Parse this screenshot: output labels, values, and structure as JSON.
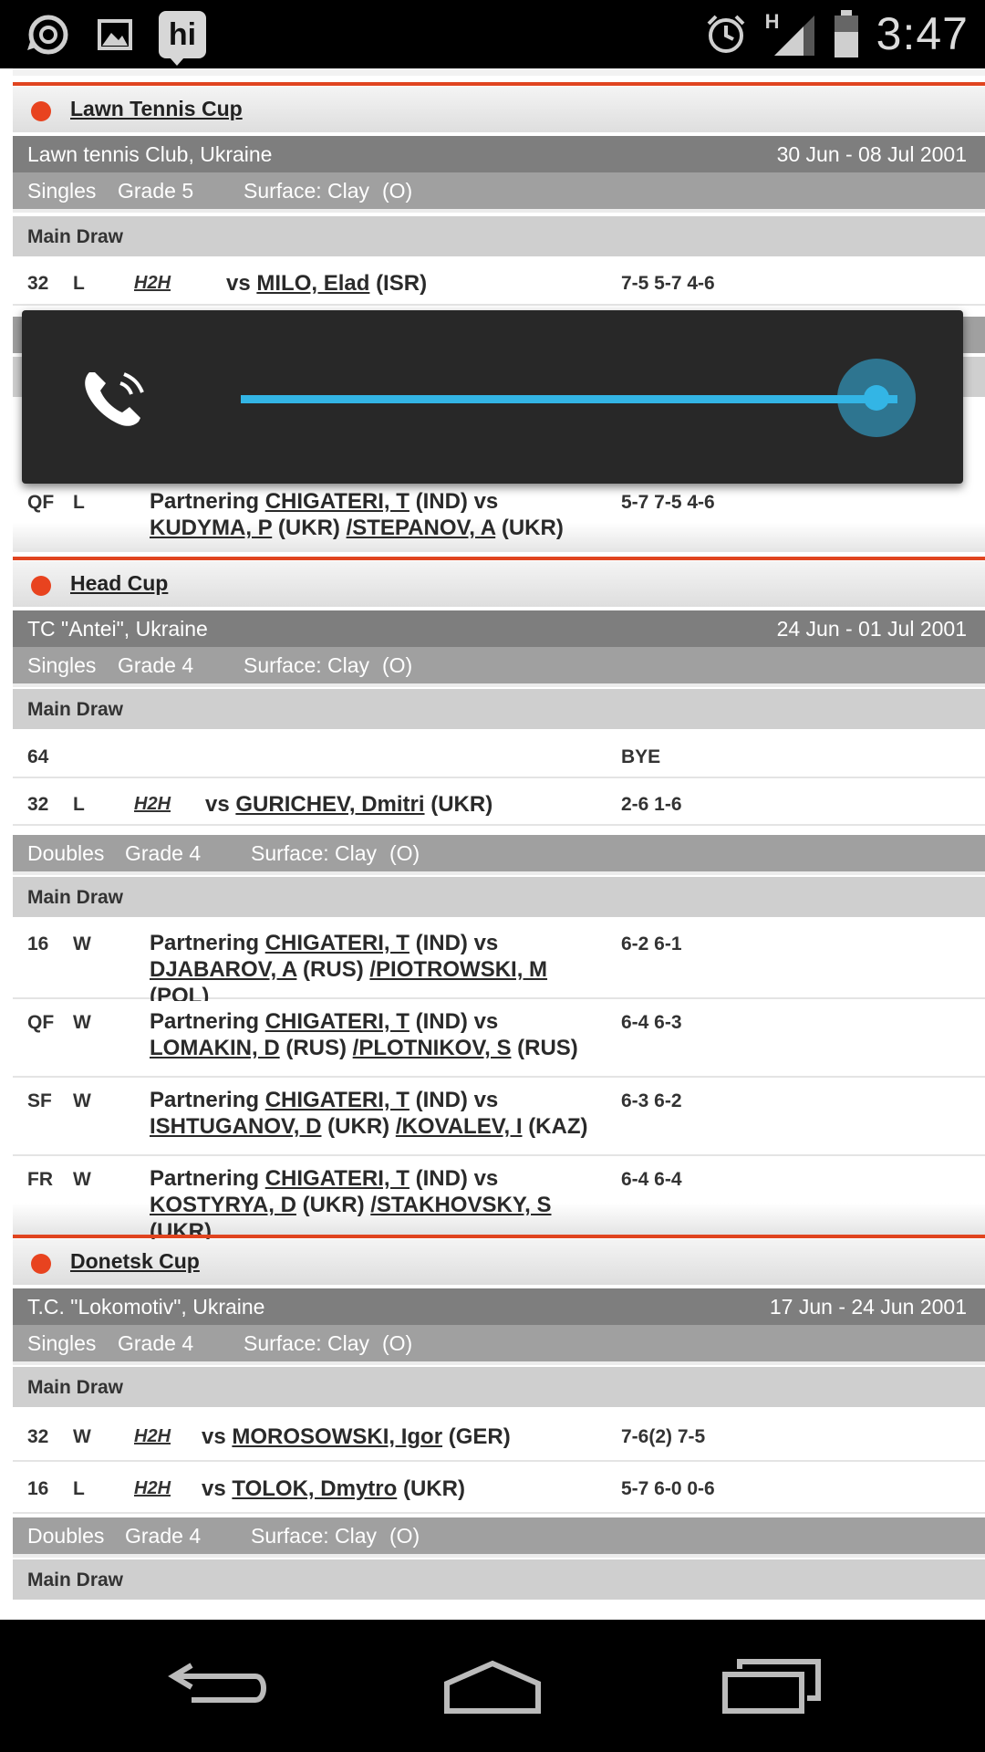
{
  "status_bar": {
    "time": "3:47",
    "network": "H",
    "icons": [
      "sync-icon",
      "image-icon",
      "hi-app-icon",
      "alarm-icon",
      "signal-icon",
      "battery-icon"
    ],
    "hi_label": "hi"
  },
  "sections": [
    {
      "title": "Lawn Tennis Cup",
      "venue": "Lawn tennis Club, Ukraine",
      "dates": "30 Jun - 08 Jul 2001",
      "events": [
        {
          "type": "Singles",
          "grade": "Grade 5",
          "surface": "Surface: Clay",
          "io": "(O)",
          "draw": "Main Draw",
          "matches": [
            {
              "round": "32",
              "result": "L",
              "h2h": "H2H",
              "vs": "vs",
              "opponent": "MILO, Elad",
              "country": "(ISR)",
              "score": "7-5 5-7 4-6"
            }
          ]
        },
        {
          "draw": "",
          "matches": [
            {
              "round": "QF",
              "result": "L",
              "partner_prefix": "Partnering",
              "partner": "CHIGATERI, T",
              "partner_country": "(IND) vs",
              "opp1": "KUDYMA, P",
              "opp1_country": "(UKR)",
              "opp2": "/STEPANOV, A",
              "opp2_country": "(UKR)",
              "score": "5-7 7-5 4-6"
            }
          ]
        }
      ]
    },
    {
      "title": "Head Cup",
      "venue": "TC \"Antei\", Ukraine",
      "dates": "24 Jun - 01 Jul 2001",
      "events": [
        {
          "type": "Singles",
          "grade": "Grade 4",
          "surface": "Surface: Clay",
          "io": "(O)",
          "draw": "Main Draw",
          "matches": [
            {
              "round": "64",
              "score": "BYE"
            },
            {
              "round": "32",
              "result": "L",
              "h2h": "H2H",
              "vs": "vs",
              "opponent": "GURICHEV, Dmitri",
              "country": "(UKR)",
              "score": "2-6 1-6"
            }
          ]
        },
        {
          "type": "Doubles",
          "grade": "Grade 4",
          "surface": "Surface: Clay",
          "io": "(O)",
          "draw": "Main Draw",
          "matches": [
            {
              "round": "16",
              "result": "W",
              "partner_prefix": "Partnering",
              "partner": "CHIGATERI, T",
              "partner_country": "(IND) vs",
              "opp1": "DJABAROV, A",
              "opp1_country": "(RUS)",
              "opp2": "/PIOTROWSKI, M",
              "opp2_country": "(POL)",
              "score": "6-2 6-1"
            },
            {
              "round": "QF",
              "result": "W",
              "partner_prefix": "Partnering",
              "partner": "CHIGATERI, T",
              "partner_country": "(IND) vs",
              "opp1": "LOMAKIN, D",
              "opp1_country": "(RUS)",
              "opp2": "/PLOTNIKOV, S",
              "opp2_country": "(RUS)",
              "score": "6-4 6-3"
            },
            {
              "round": "SF",
              "result": "W",
              "partner_prefix": "Partnering",
              "partner": "CHIGATERI, T",
              "partner_country": "(IND) vs",
              "opp1": "ISHTUGANOV, D",
              "opp1_country": "(UKR)",
              "opp2": "/KOVALEV, I",
              "opp2_country": "(KAZ)",
              "score": "6-3 6-2"
            },
            {
              "round": "FR",
              "result": "W",
              "partner_prefix": "Partnering",
              "partner": "CHIGATERI, T",
              "partner_country": "(IND) vs",
              "opp1": "KOSTYRYA, D",
              "opp1_country": "(UKR)",
              "opp2": "/STAKHOVSKY, S",
              "opp2_country": "(UKR)",
              "score": "6-4 6-4"
            }
          ]
        }
      ]
    },
    {
      "title": "Donetsk Cup",
      "venue": "T.C. \"Lokomotiv\", Ukraine",
      "dates": "17 Jun - 24 Jun 2001",
      "events": [
        {
          "type": "Singles",
          "grade": "Grade 4",
          "surface": "Surface: Clay",
          "io": "(O)",
          "draw": "Main Draw",
          "matches": [
            {
              "round": "32",
              "result": "W",
              "h2h": "H2H",
              "vs": "vs",
              "opponent": "MOROSOWSKI, Igor",
              "country": "(GER)",
              "score": "7-6(2) 7-5"
            },
            {
              "round": "16",
              "result": "L",
              "h2h": "H2H",
              "vs": "vs",
              "opponent": "TOLOK, Dmytro",
              "country": "(UKR)",
              "score": "5-7 6-0 0-6"
            }
          ]
        },
        {
          "type": "Doubles",
          "grade": "Grade 4",
          "surface": "Surface: Clay",
          "io": "(O)",
          "draw": "Main Draw",
          "matches": []
        }
      ]
    }
  ],
  "volume_overlay": {
    "stream_icon": "phone-in-call-icon",
    "level": 1.0,
    "accent": "#33b5e5"
  },
  "nav_bar": {
    "buttons": [
      "back-icon",
      "home-icon",
      "recent-apps-icon"
    ]
  },
  "colors": {
    "accent_orange": "#e0441f",
    "venue_bar": "#7e7e7e",
    "grade_bar": "#a0a0a0",
    "draw_bar": "#cfcfcf"
  }
}
